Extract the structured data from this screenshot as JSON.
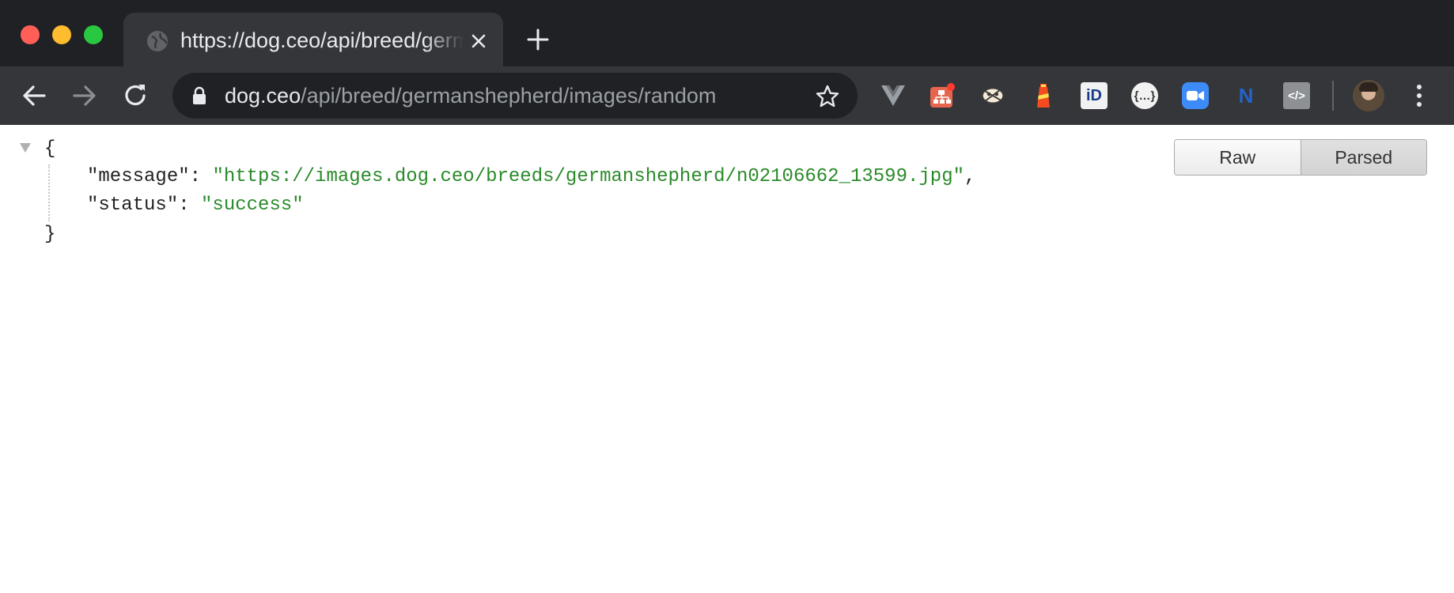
{
  "browser": {
    "tab": {
      "title": "https://dog.ceo/api/breed/germanshepherd/images/random"
    },
    "address_bar": {
      "host": "dog.ceo",
      "path": "/api/breed/germanshepherd/images/random"
    },
    "extensions": [
      {
        "name": "vue-devtools-icon",
        "label": ""
      },
      {
        "name": "sitemap-extension-icon",
        "label": ""
      },
      {
        "name": "bug-extension-icon",
        "label": ""
      },
      {
        "name": "lighthouse-icon",
        "label": ""
      },
      {
        "name": "id-extension-icon",
        "label": "iD"
      },
      {
        "name": "json-formatter-icon",
        "label": "{…}"
      },
      {
        "name": "zoom-icon",
        "label": ""
      },
      {
        "name": "n-extension-icon",
        "label": "N"
      },
      {
        "name": "code-extension-icon",
        "label": "</>"
      }
    ]
  },
  "json_view": {
    "brace_open": "{",
    "brace_close": "}",
    "entries": [
      {
        "key": "\"message\"",
        "colon": ": ",
        "value": "\"https://images.dog.ceo/breeds/germanshepherd/n02106662_13599.jpg\"",
        "comma": ","
      },
      {
        "key": "\"status\"",
        "colon": ": ",
        "value": "\"success\"",
        "comma": ""
      }
    ],
    "toggle": {
      "raw_label": "Raw",
      "parsed_label": "Parsed",
      "active": "Parsed"
    }
  }
}
